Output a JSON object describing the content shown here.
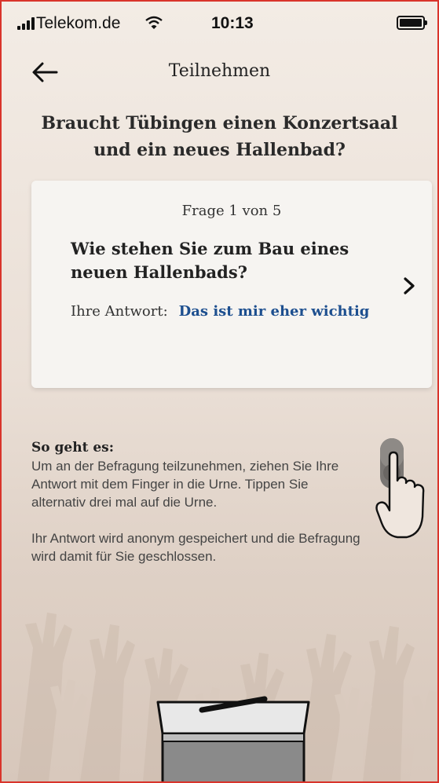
{
  "status_bar": {
    "carrier": "Telekom.de",
    "time": "10:13",
    "signal_icon": "signal-bars-icon",
    "wifi_icon": "wifi-icon",
    "battery_icon": "battery-icon"
  },
  "nav": {
    "back_icon": "arrow-left-icon",
    "title": "Teilnehmen"
  },
  "survey": {
    "title": "Braucht Tübingen einen Konzertsaal und ein neues Hallenbad?"
  },
  "question_card": {
    "counter": "Frage 1 von 5",
    "question": "Wie stehen Sie zum Bau eines neuen Hallenbads?",
    "answer_label": "Ihre Antwort:",
    "answer_value": "Das ist mir eher wichtig",
    "next_icon": "chevron-right-icon"
  },
  "instructions": {
    "heading": "So geht es:",
    "paragraph_1": "Um an der Befragung teilzunehmen, ziehen Sie Ihre Antwort mit dem Finger in die Urne. Tippen Sie alternativ drei mal auf die Urne.",
    "paragraph_2": "Ihr Antwort wird anonym gespeichert und die Befragung wird damit für Sie geschlossen.",
    "gesture_icon": "drag-finger-icon"
  },
  "ballot_box": {
    "icon": "ballot-box-icon"
  },
  "colors": {
    "accent_blue": "#1d4f8f",
    "background": "#efe6de",
    "card": "#f6f4f1",
    "border": "#d9342b"
  }
}
